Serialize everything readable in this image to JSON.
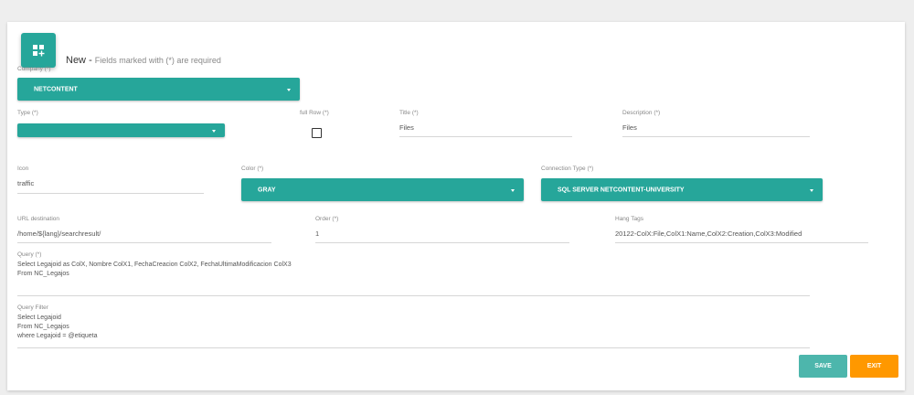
{
  "header": {
    "title": "New",
    "separator": " - ",
    "subtitle": "Fields marked with (*) are required",
    "icon": "grid-plus-icon"
  },
  "form": {
    "company": {
      "label": "Company (*)",
      "value": "NETCONTENT"
    },
    "type": {
      "label": "Type (*)",
      "value": ""
    },
    "full_row": {
      "label": "full Row (*)",
      "checked": false
    },
    "title": {
      "label": "Title (*)",
      "value": "Files"
    },
    "description": {
      "label": "Description (*)",
      "value": "Files"
    },
    "icon": {
      "label": "Icon",
      "value": "traffic"
    },
    "color": {
      "label": "Color (*)",
      "value": "GRAY"
    },
    "connection_type": {
      "label": "Connection Type (*)",
      "value": "SQL SERVER NETCONTENT-UNIVERSITY"
    },
    "url_destination": {
      "label": "URL destination",
      "value": "/home/${lang}/searchresult/"
    },
    "order": {
      "label": "Order (*)",
      "value": "1"
    },
    "hang_tags": {
      "label": "Hang Tags",
      "value": "20122-ColX:File,ColX1:Name,ColX2:Creation,ColX3:Modified"
    },
    "query": {
      "label": "Query (*)",
      "lines": [
        "Select Legajoid as ColX, Nombre ColX1, FechaCreacion ColX2, FechaUltimaModificacion ColX3",
        "From NC_Legajos"
      ]
    },
    "query_filter": {
      "label": "Query Filter",
      "lines": [
        "Select Legajoid",
        "From NC_Legajos",
        "where Legajoid = @etiqueta"
      ]
    }
  },
  "actions": {
    "save_label": "SAVE",
    "exit_label": "EXIT"
  },
  "colors": {
    "accent": "#26a69a",
    "exit": "#ff9800"
  }
}
